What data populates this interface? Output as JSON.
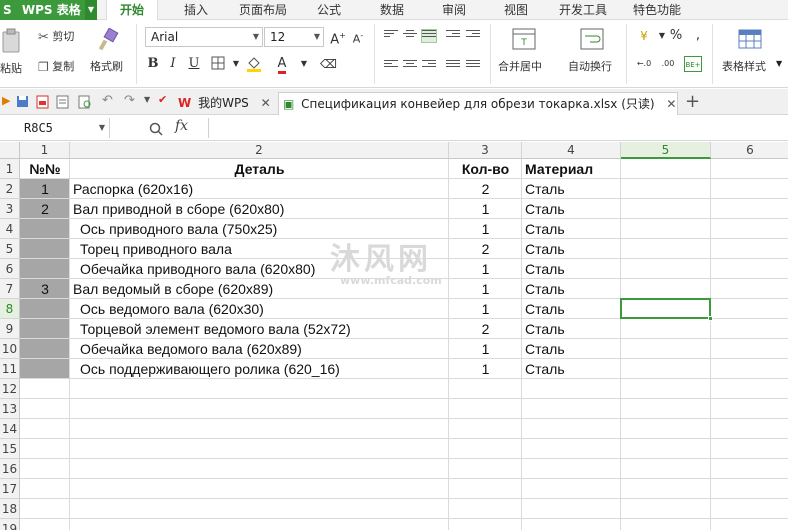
{
  "app": {
    "name": "WPS 表格",
    "icon_glyph": "S"
  },
  "menu_tabs": [
    "开始",
    "插入",
    "页面布局",
    "公式",
    "数据",
    "审阅",
    "视图",
    "开发工具",
    "特色功能"
  ],
  "ribbon": {
    "paste_label": "粘贴",
    "cut_label": "剪切",
    "copy_label": "复制",
    "format_painter_label": "格式刷",
    "font_name": "Arial",
    "font_size": "12",
    "merge_center_label": "合并居中",
    "wrap_text_label": "自动换行",
    "table_style_label": "表格样式",
    "bold": "B",
    "italic": "I",
    "underline": "U",
    "font_color_letter": "A",
    "increase_font": "A",
    "decrease_font": "A"
  },
  "doc_tabs": [
    {
      "label": "我的WPS"
    },
    {
      "label": "Спецификация конвейер для обрези токарка.xlsx (只读)"
    }
  ],
  "formula_bar": {
    "name_box": "R8C5",
    "fx": "fx",
    "value": ""
  },
  "columns": [
    "1",
    "2",
    "3",
    "4",
    "5",
    "6"
  ],
  "rows": [
    "1",
    "2",
    "3",
    "4",
    "5",
    "6",
    "7",
    "8",
    "9",
    "10",
    "11",
    "12",
    "13",
    "14",
    "15",
    "16",
    "17",
    "18",
    "19"
  ],
  "table": {
    "headers": [
      "№№",
      "Деталь",
      "Кол-во",
      "Материал"
    ],
    "rows": [
      {
        "num": "1",
        "part": "Распорка (620х16)",
        "qty": "2",
        "mat": "Сталь",
        "indent": false
      },
      {
        "num": "2",
        "part": "Вал приводной в сборе (620х80)",
        "qty": "1",
        "mat": "Сталь",
        "indent": false
      },
      {
        "num": "",
        "part": "Ось приводного вала (750х25)",
        "qty": "1",
        "mat": "Сталь",
        "indent": true
      },
      {
        "num": "",
        "part": "Торец приводного вала",
        "qty": "2",
        "mat": "Сталь",
        "indent": true
      },
      {
        "num": "",
        "part": "Обечайка приводного вала (620х80)",
        "qty": "1",
        "mat": "Сталь",
        "indent": true
      },
      {
        "num": "3",
        "part": "Вал ведомый в сборе (620х89)",
        "qty": "1",
        "mat": "Сталь",
        "indent": false
      },
      {
        "num": "",
        "part": "Ось ведомого вала (620х30)",
        "qty": "1",
        "mat": "Сталь",
        "indent": true
      },
      {
        "num": "",
        "part": "Торцевой элемент ведомого вала (52х72)",
        "qty": "2",
        "mat": "Сталь",
        "indent": true
      },
      {
        "num": "",
        "part": "Обечайка ведомого вала (620х89)",
        "qty": "1",
        "mat": "Сталь",
        "indent": true
      },
      {
        "num": "",
        "part": "Ось поддерживающего ролика (620_16)",
        "qty": "1",
        "mat": "Сталь",
        "indent": true
      }
    ]
  },
  "watermark": {
    "title": "沐风网",
    "url": "www.mfcad.com"
  },
  "colors": {
    "accent": "#3c9a3c",
    "gray_fill": "#a6a6a6"
  }
}
